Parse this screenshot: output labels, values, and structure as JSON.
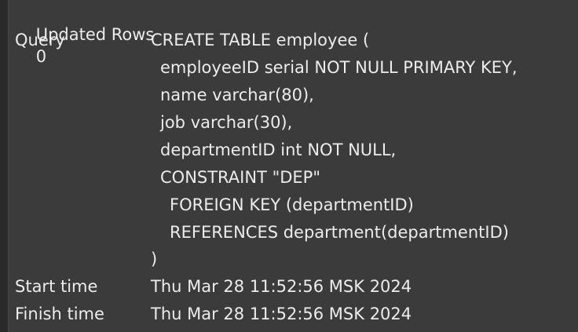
{
  "results": {
    "updated_rows_label": "Updated Rows",
    "updated_rows_value": "0",
    "query_label": "Query",
    "query_lines": [
      "CREATE TABLE employee (",
      "employeeID serial NOT NULL PRIMARY KEY,",
      "name varchar(80),",
      "job varchar(30),",
      "departmentID int NOT NULL,",
      "CONSTRAINT \"DEP\"",
      "FOREIGN KEY (departmentID)",
      "REFERENCES department(departmentID)",
      ")"
    ],
    "start_time_label": "Start time",
    "start_time_value": "Thu Mar 28 11:52:56 MSK 2024",
    "finish_time_label": "Finish time",
    "finish_time_value": "Thu Mar 28 11:52:56 MSK 2024"
  },
  "colors": {
    "background": "#3b3b3b",
    "text": "#ececec",
    "gutter": "#2a2a2a"
  }
}
